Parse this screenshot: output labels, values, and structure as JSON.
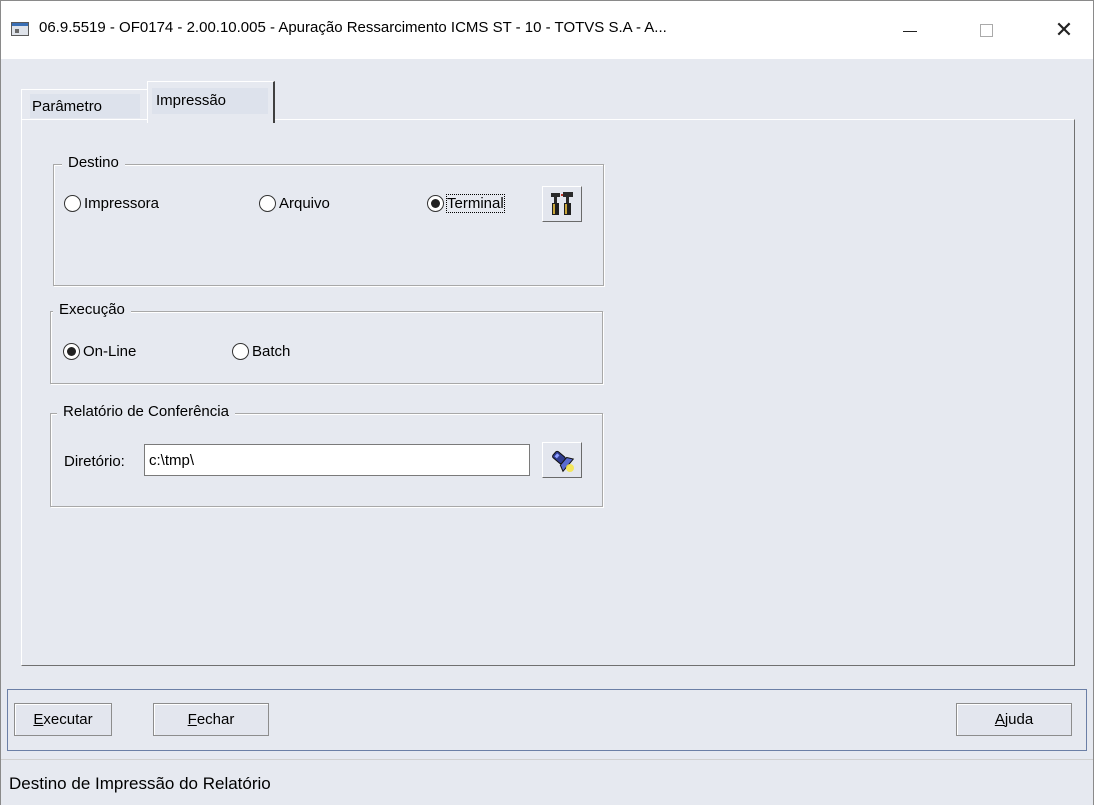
{
  "window": {
    "title": "06.9.5519 - OF0174 - 2.00.10.005 - Apuração Ressarcimento ICMS ST - 10 - TOTVS S.A - A..."
  },
  "tabs": [
    {
      "label": "Parâmetro",
      "selected": false
    },
    {
      "label": "Impressão",
      "selected": true
    }
  ],
  "destino": {
    "title": "Destino",
    "options": [
      {
        "label": "Impressora",
        "checked": false
      },
      {
        "label": "Arquivo",
        "checked": false
      },
      {
        "label": "Terminal",
        "checked": true
      }
    ],
    "setup_icon": "printer-setup-icon"
  },
  "execucao": {
    "title": "Execução",
    "options": [
      {
        "label": "On-Line",
        "checked": true
      },
      {
        "label": "Batch",
        "checked": false
      }
    ]
  },
  "relatorio": {
    "title": "Relatório de Conferência",
    "dir_label": "Diretório:",
    "dir_value": "c:\\tmp\\",
    "browse_icon": "flashlight-search-icon"
  },
  "buttons": {
    "executar_mn": "E",
    "executar_rest": "xecutar",
    "fechar_mn": "F",
    "fechar_rest": "echar",
    "ajuda_mn": "A",
    "ajuda_rest": "juda"
  },
  "status": {
    "text": "Destino de Impressão do Relatório"
  }
}
